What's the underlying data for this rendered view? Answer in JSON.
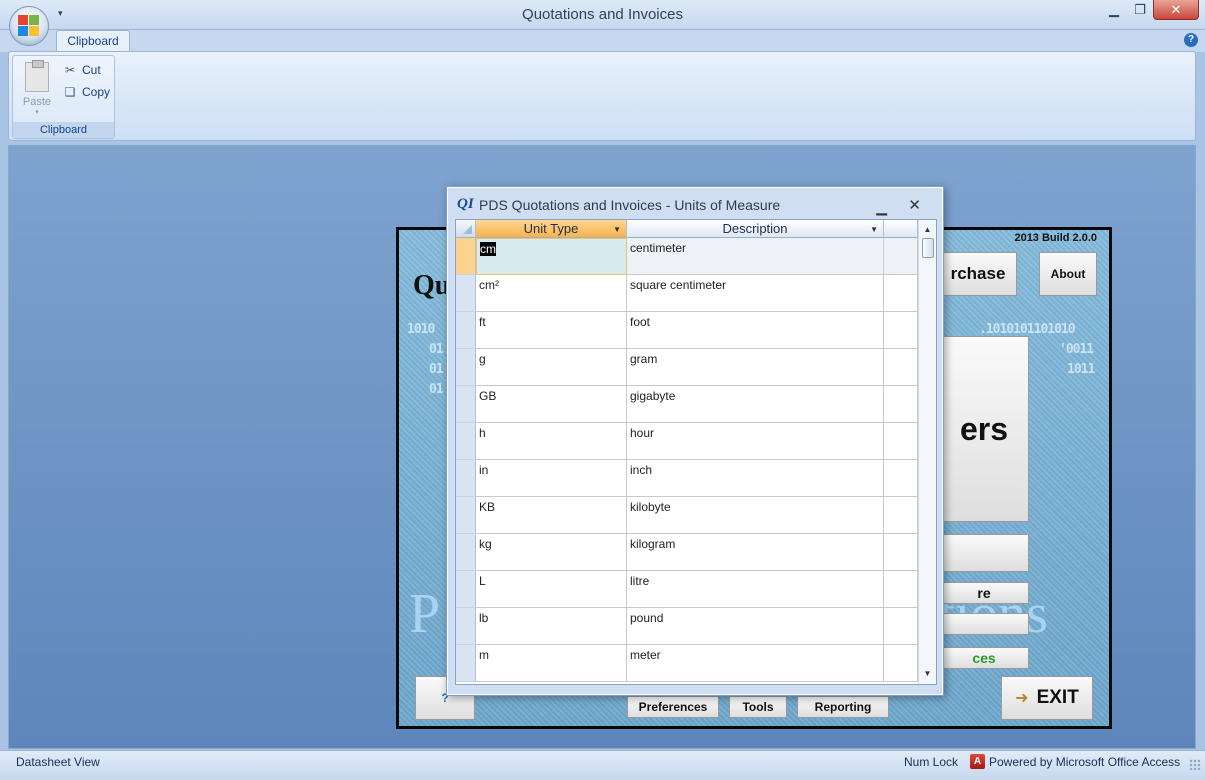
{
  "window": {
    "title": "Quotations and Invoices"
  },
  "ribbon": {
    "tabs": [
      "Clipboard"
    ],
    "groups": [
      {
        "label": "Clipboard",
        "paste_label": "Paste",
        "cut_label": "Cut",
        "copy_label": "Copy"
      }
    ]
  },
  "switchboard": {
    "build_label": "2013 Build 2.0.0",
    "partial_title": "Qu",
    "buttons": {
      "purchase": "rchase",
      "about": "About",
      "big": "ers",
      "measure": "re",
      "invoices": "ces",
      "preferences": "Preferences",
      "tools": "Tools",
      "reporting": "Reporting",
      "exit": "EXIT"
    }
  },
  "dialog": {
    "logo": "QI",
    "title": "PDS Quotations and Invoices - Units of Measure",
    "columns": [
      "Unit Type",
      "Description"
    ],
    "rows": [
      {
        "unit": "cm",
        "description": "centimeter"
      },
      {
        "unit": "cm²",
        "description": "square centimeter"
      },
      {
        "unit": "ft",
        "description": "foot"
      },
      {
        "unit": "g",
        "description": "gram"
      },
      {
        "unit": "GB",
        "description": "gigabyte"
      },
      {
        "unit": "h",
        "description": "hour"
      },
      {
        "unit": "in",
        "description": "inch"
      },
      {
        "unit": "KB",
        "description": "kilobyte"
      },
      {
        "unit": "kg",
        "description": "kilogram"
      },
      {
        "unit": "L",
        "description": "litre"
      },
      {
        "unit": "lb",
        "description": "pound"
      },
      {
        "unit": "m",
        "description": "meter"
      }
    ]
  },
  "statusbar": {
    "view": "Datasheet View",
    "num_lock": "Num Lock",
    "powered": "Powered by Microsoft Office Access"
  },
  "colors": {
    "accent": "#15428b",
    "selected_header": "#f8b24c",
    "close": "#c7483a"
  }
}
